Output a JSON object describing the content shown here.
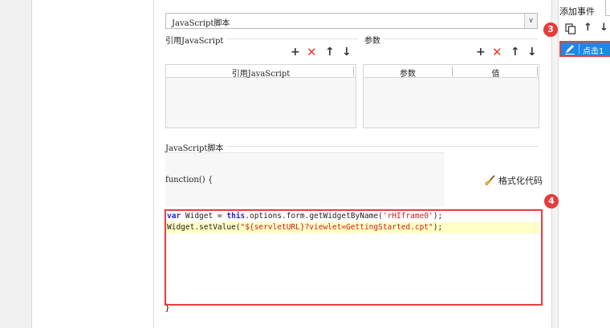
{
  "dialog": {
    "script_type_select": {
      "value": "JavaScript脚本"
    },
    "imports": {
      "label": "引用JavaScript",
      "column": "引用JavaScript",
      "tools": {
        "add": "+",
        "remove": "✕",
        "up": "↑",
        "down": "↓"
      }
    },
    "params": {
      "label": "参数",
      "columns": [
        "参数",
        "值"
      ],
      "tools": {
        "add": "+",
        "remove": "✕",
        "up": "↑",
        "down": "↓"
      }
    },
    "script": {
      "label": "JavaScript脚本",
      "function_header": "function() {",
      "format_button": "格式化代码",
      "code": {
        "line1": {
          "kw_var": "var",
          "a": " Widget = ",
          "kw_this": "this",
          "b": ".options.form.getWidgetByName(",
          "str": "'rHIframe0'",
          "c": ");"
        },
        "line2": {
          "a": "Widget.setValue(",
          "str": "\"${servletURL}?viewlet=GettingStarted.cpt\"",
          "c": ");"
        }
      },
      "closing_brace": "}"
    }
  },
  "right_panel": {
    "title": "添加事件",
    "tools": {
      "copy_icon": "copy-icon",
      "up": "↑",
      "down": "↓"
    },
    "event_item_label": "点击1"
  },
  "badges": {
    "step3": "3",
    "step4": "4"
  },
  "colors": {
    "accent_red": "#e24444",
    "selection_blue": "#1e88e5",
    "keyword_blue": "#1f1fdc",
    "string_red": "#c81f1f",
    "highlight_line": "#ffffc6"
  }
}
